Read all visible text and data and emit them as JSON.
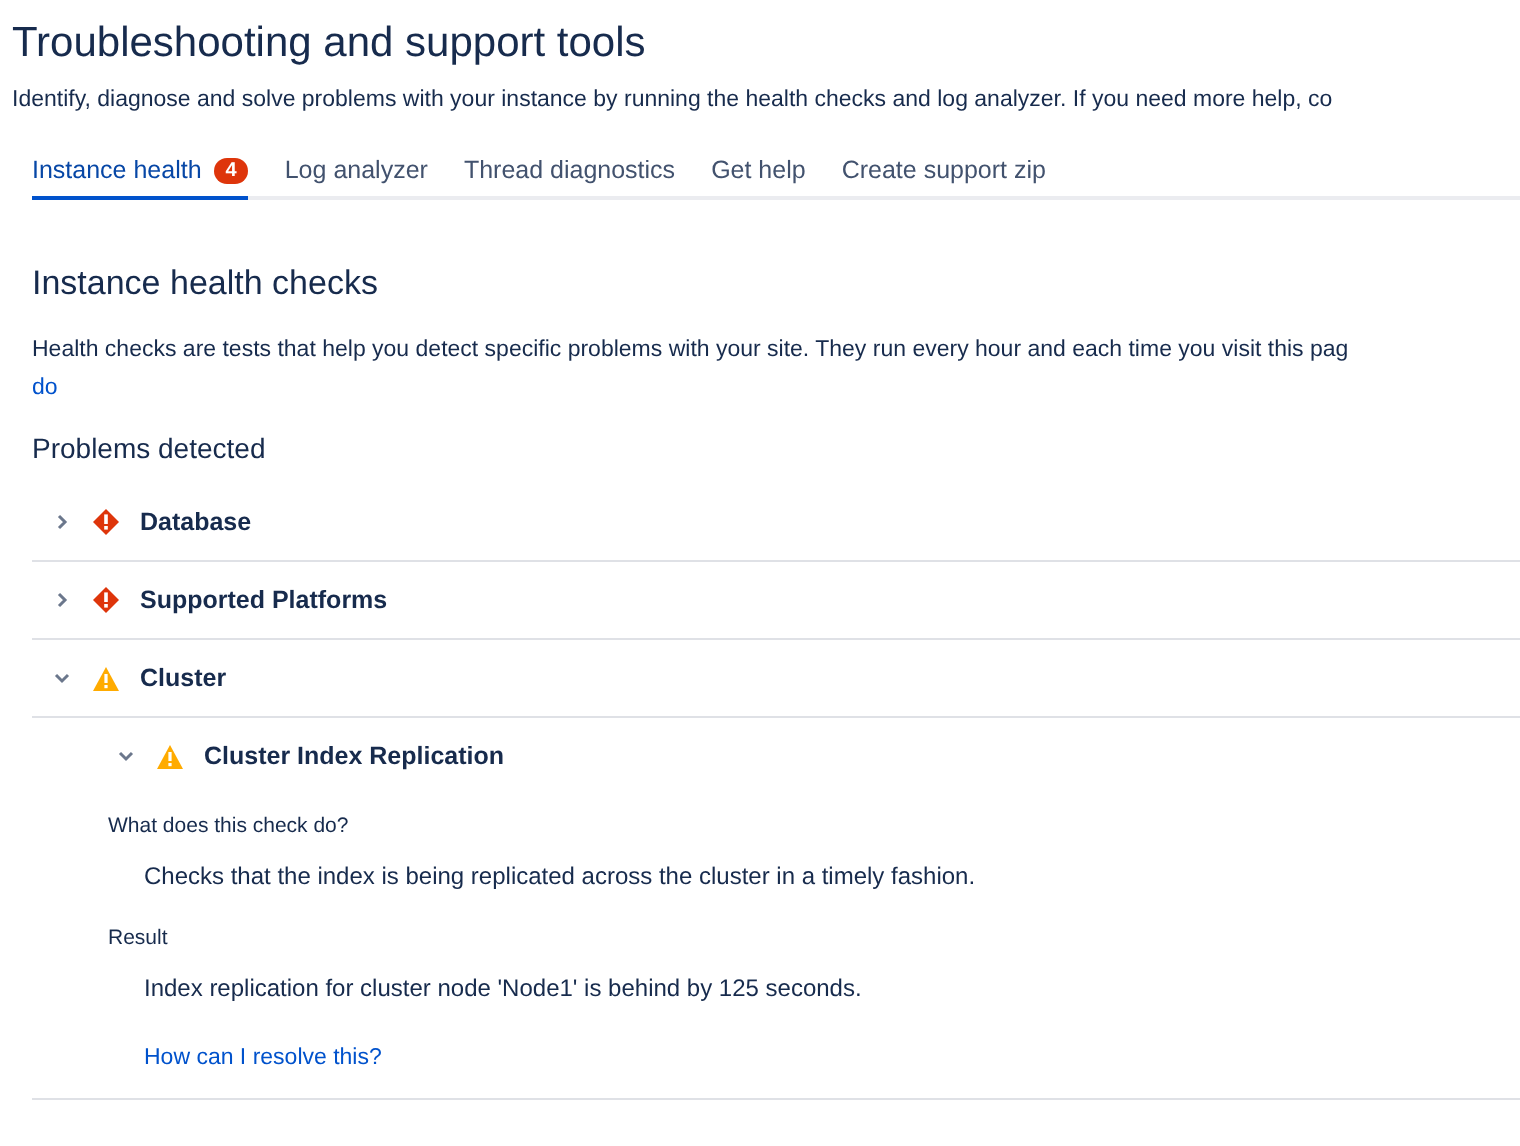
{
  "page": {
    "title": "Troubleshooting and support tools",
    "description": "Identify, diagnose and solve problems with your instance by running the health checks and log analyzer. If you need more help, co"
  },
  "tabs": [
    {
      "label": "Instance health",
      "badge": "4",
      "selected": true
    },
    {
      "label": "Log analyzer",
      "selected": false
    },
    {
      "label": "Thread diagnostics",
      "selected": false
    },
    {
      "label": "Get help",
      "selected": false
    },
    {
      "label": "Create support zip",
      "selected": false
    }
  ],
  "section": {
    "title": "Instance health checks",
    "description": "Health checks are tests that help you detect specific problems with your site. They run every hour and each time you visit this pag",
    "description_link": "do",
    "subtitle": "Problems detected"
  },
  "problems": [
    {
      "name": "Database",
      "kind": "error",
      "expanded": false
    },
    {
      "name": "Supported Platforms",
      "kind": "error",
      "expanded": false
    },
    {
      "name": "Cluster",
      "kind": "warning",
      "expanded": true,
      "children": [
        {
          "name": "Cluster Index Replication",
          "kind": "warning",
          "expanded": true,
          "details": [
            {
              "label": "What does this check do?",
              "text": "Checks that the index is being replicated across the cluster in a timely fashion."
            },
            {
              "label": "Result",
              "text": "Index replication for cluster node 'Node1' is behind by 125 seconds.",
              "link": "How can I resolve this?"
            }
          ]
        }
      ]
    }
  ]
}
